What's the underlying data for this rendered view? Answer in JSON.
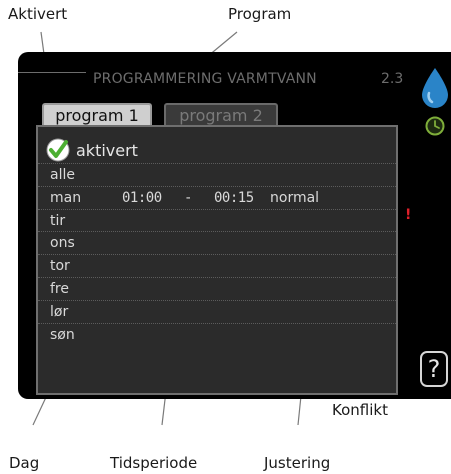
{
  "callouts": {
    "aktivert": "Aktivert",
    "program": "Program",
    "konflikt": "Konflikt",
    "dag": "Dag",
    "tidsperiode": "Tidsperiode",
    "justering": "Justering"
  },
  "screen": {
    "title": "PROGRAMMERING VARMTVANN",
    "menu_number": "2.3",
    "tabs": [
      {
        "label": "program 1",
        "active": true
      },
      {
        "label": "program 2",
        "active": false
      }
    ],
    "active_label": "aktivert",
    "active_checked": true,
    "days": [
      {
        "label": "alle"
      },
      {
        "label": "man",
        "start": "01:00",
        "separator": "-",
        "end": "00:15",
        "mode": "normal"
      },
      {
        "label": "tir"
      },
      {
        "label": "ons"
      },
      {
        "label": "tor"
      },
      {
        "label": "fre"
      },
      {
        "label": "lør"
      },
      {
        "label": "søn"
      }
    ],
    "conflict_mark": "!",
    "help_label": "?",
    "icons": [
      "water-drop-icon",
      "clock-icon",
      "checkmark-icon"
    ],
    "colors": {
      "screen_bg": "#000000",
      "panel_bg": "#2b2b2b",
      "check_green": "#4caf32",
      "drop_blue": "#2a84c8",
      "conflict_red": "#e0202a"
    }
  }
}
